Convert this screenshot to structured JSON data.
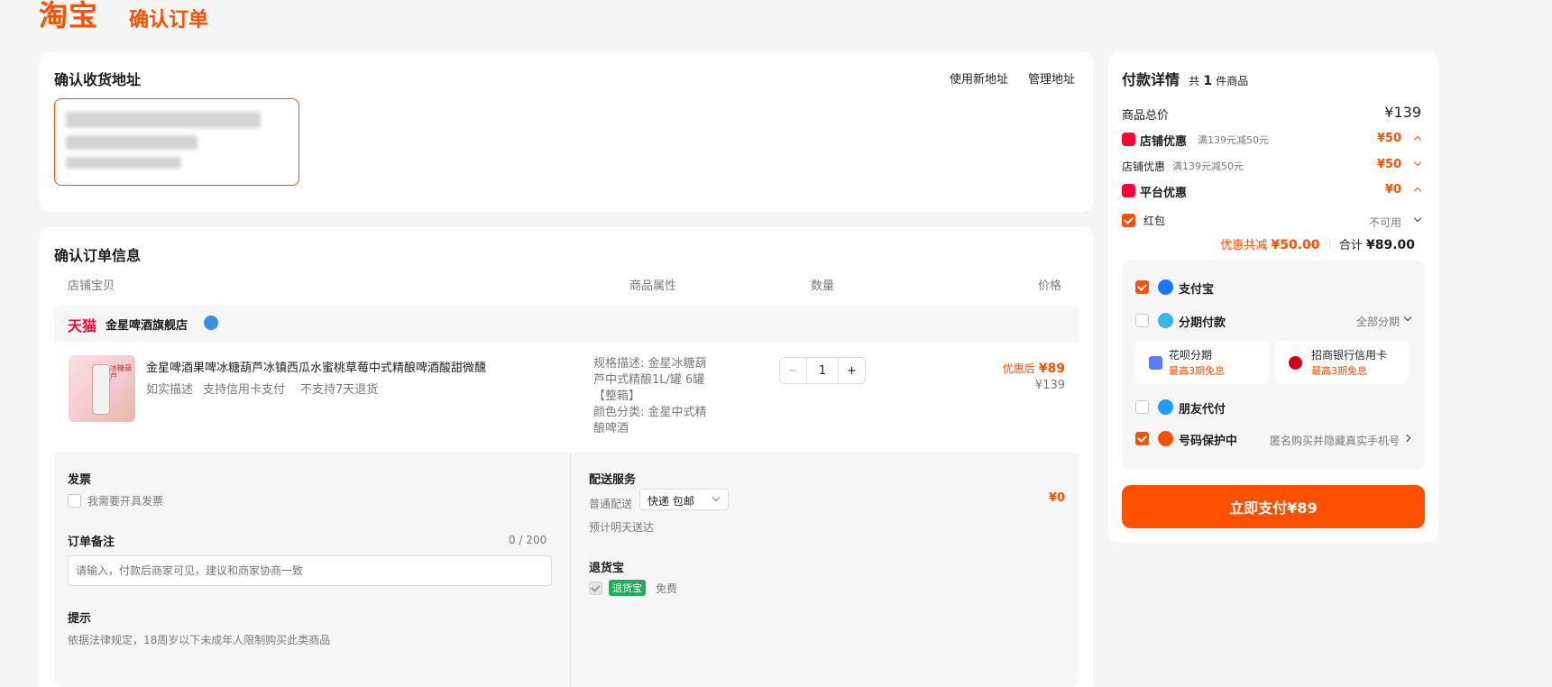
{
  "header": {
    "logo": "淘宝",
    "title": "确认订单"
  },
  "address": {
    "title": "确认收货地址",
    "new_address": "使用新地址",
    "manage": "管理地址"
  },
  "order": {
    "title": "确认订单信息",
    "columns": [
      "店铺宝贝",
      "商品属性",
      "数量",
      "价格"
    ],
    "shop_platform": "天猫",
    "shop_name": "金星啤酒旗舰店",
    "product": {
      "name": "金星啤酒果啤冰糖葫芦冰镇西瓜水蜜桃草莓中式精酿啤酒酸甜微醺",
      "tags": [
        "如实描述",
        "支持信用卡支付",
        "不支持7天退货"
      ],
      "spec_lines": [
        "规格描述: 金星冰糖葫",
        "芦中式精酿1L/罐 6罐",
        "【整箱】",
        "颜色分类: 金星中式精",
        "酿啤酒"
      ],
      "quantity": "1",
      "minus": "−",
      "plus": "+",
      "discount_label": "优惠后",
      "discount_price": "¥89",
      "original_price": "¥139",
      "image_text": "冰糖葫芦"
    },
    "invoice": {
      "title": "发票",
      "option": "我需要开具发票"
    },
    "remark": {
      "title": "订单备注",
      "counter": "0 / 200",
      "placeholder": "请输入，付款后商家可见，建议和商家协商一致"
    },
    "notice": {
      "title": "提示",
      "text": "依据法律规定，18周岁以下未成年人限制购买此类商品"
    },
    "delivery": {
      "title": "配送服务",
      "label": "普通配送",
      "select": "快递 包邮",
      "eta": "预计明天送达",
      "fee": "¥0"
    },
    "returns": {
      "title": "退货宝",
      "badge": "退货宝",
      "free": "免费"
    }
  },
  "payment": {
    "title": "付款详情",
    "count_prefix": "共",
    "count": "1",
    "count_suffix": "件商品",
    "total_label": "商品总价",
    "total": "¥139",
    "shop_discount": {
      "label": "店铺优惠",
      "rule": "满139元减50元",
      "amount": "¥50"
    },
    "shop_discount_sub": {
      "label": "店铺优惠",
      "rule": "满139元减50元",
      "amount": "¥50"
    },
    "platform_discount": {
      "label": "平台优惠",
      "amount": "¥0"
    },
    "red_packet": {
      "label": "红包",
      "status": "不可用"
    },
    "saved_label": "优惠共减",
    "saved": "¥50.00",
    "sum_label": "合计",
    "sum": "¥89.00",
    "methods": {
      "alipay": "支付宝",
      "installment": "分期付款",
      "installment_all": "全部分期",
      "huabei": {
        "name": "花呗分期",
        "promo": "最高3期免息"
      },
      "cmb": {
        "name": "招商银行信用卡",
        "promo": "最高3期免息"
      },
      "friend": "朋友代付",
      "privacy": "号码保护中",
      "privacy_desc": "匿名购买并隐藏真实手机号"
    },
    "pay_button": "立即支付¥89"
  },
  "colors": {
    "accent": "#ff5000",
    "tmall": "#ff0036",
    "returns_green": "#1fad5a"
  }
}
